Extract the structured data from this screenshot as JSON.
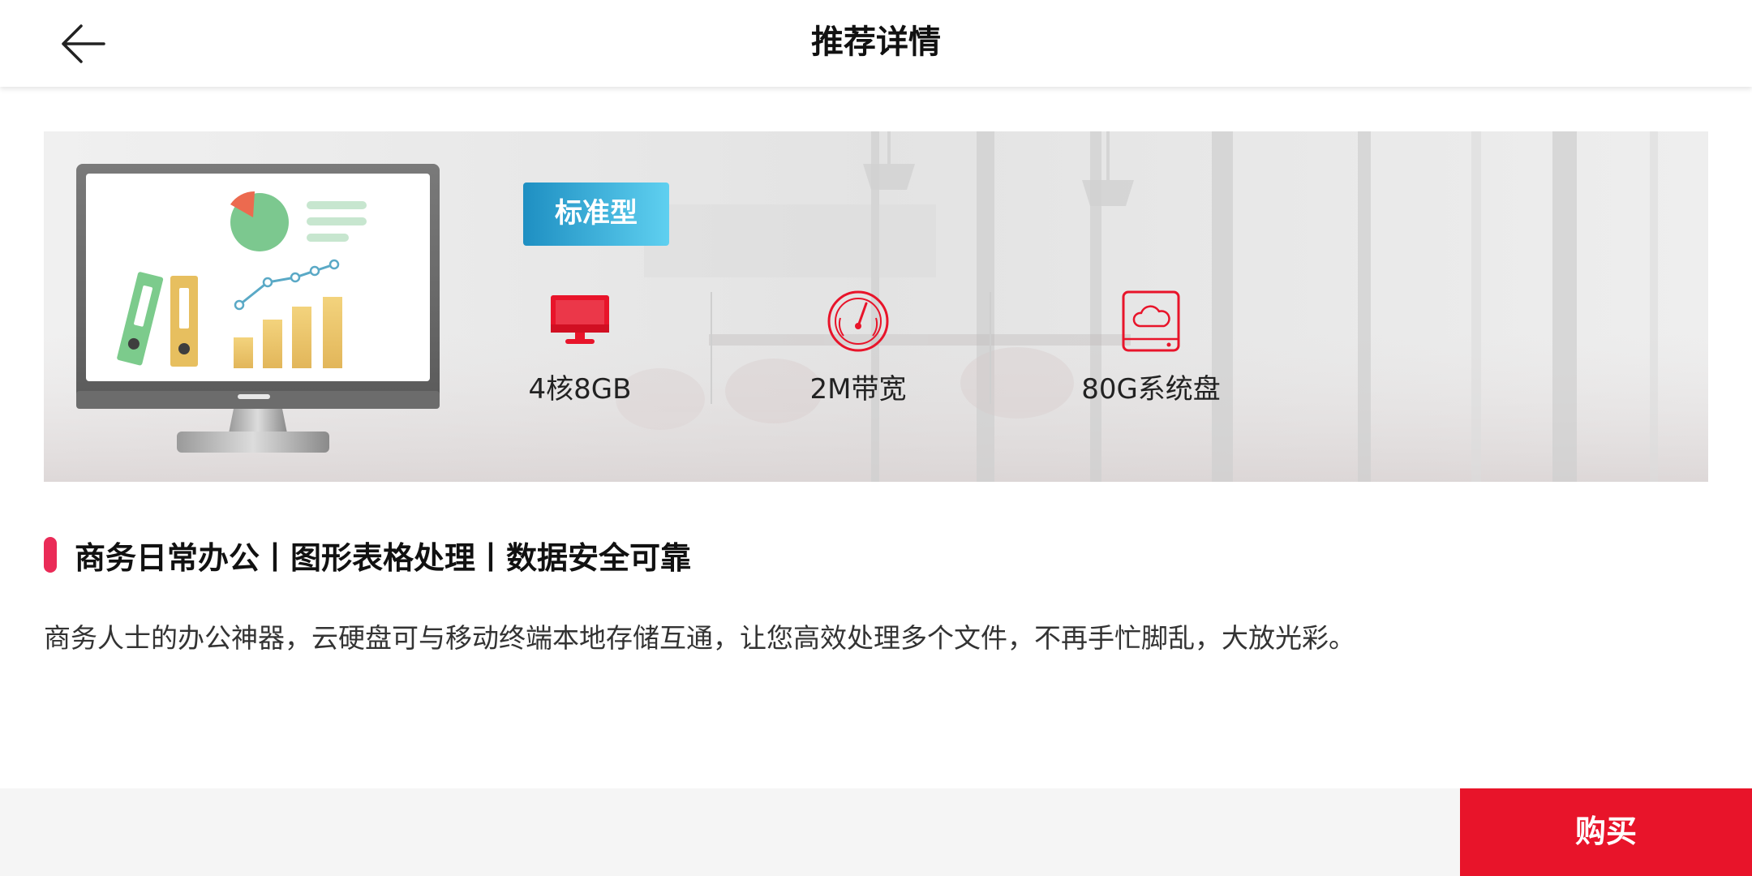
{
  "header": {
    "title": "推荐详情",
    "back_icon": "arrow-left-icon"
  },
  "banner": {
    "type_badge": "标准型",
    "specs": [
      {
        "icon": "monitor-icon",
        "label": "4核8GB"
      },
      {
        "icon": "speedometer-icon",
        "label": "2M带宽"
      },
      {
        "icon": "cloud-disk-icon",
        "label": "80G系统盘"
      }
    ]
  },
  "features": {
    "text": "商务日常办公丨图形表格处理丨数据安全可靠"
  },
  "description": "商务人士的办公神器，云硬盘可与移动终端本地存储互通，让您高效处理多个文件，不再手忙脚乱，大放光彩。",
  "footer": {
    "buy_label": "购买"
  },
  "colors": {
    "accent_red": "#e8142a",
    "feature_mark": "#ea2b57",
    "badge_gradient_start": "#1e8fc2",
    "badge_gradient_end": "#5fd0f0",
    "spec_icon": "#e8142a"
  }
}
